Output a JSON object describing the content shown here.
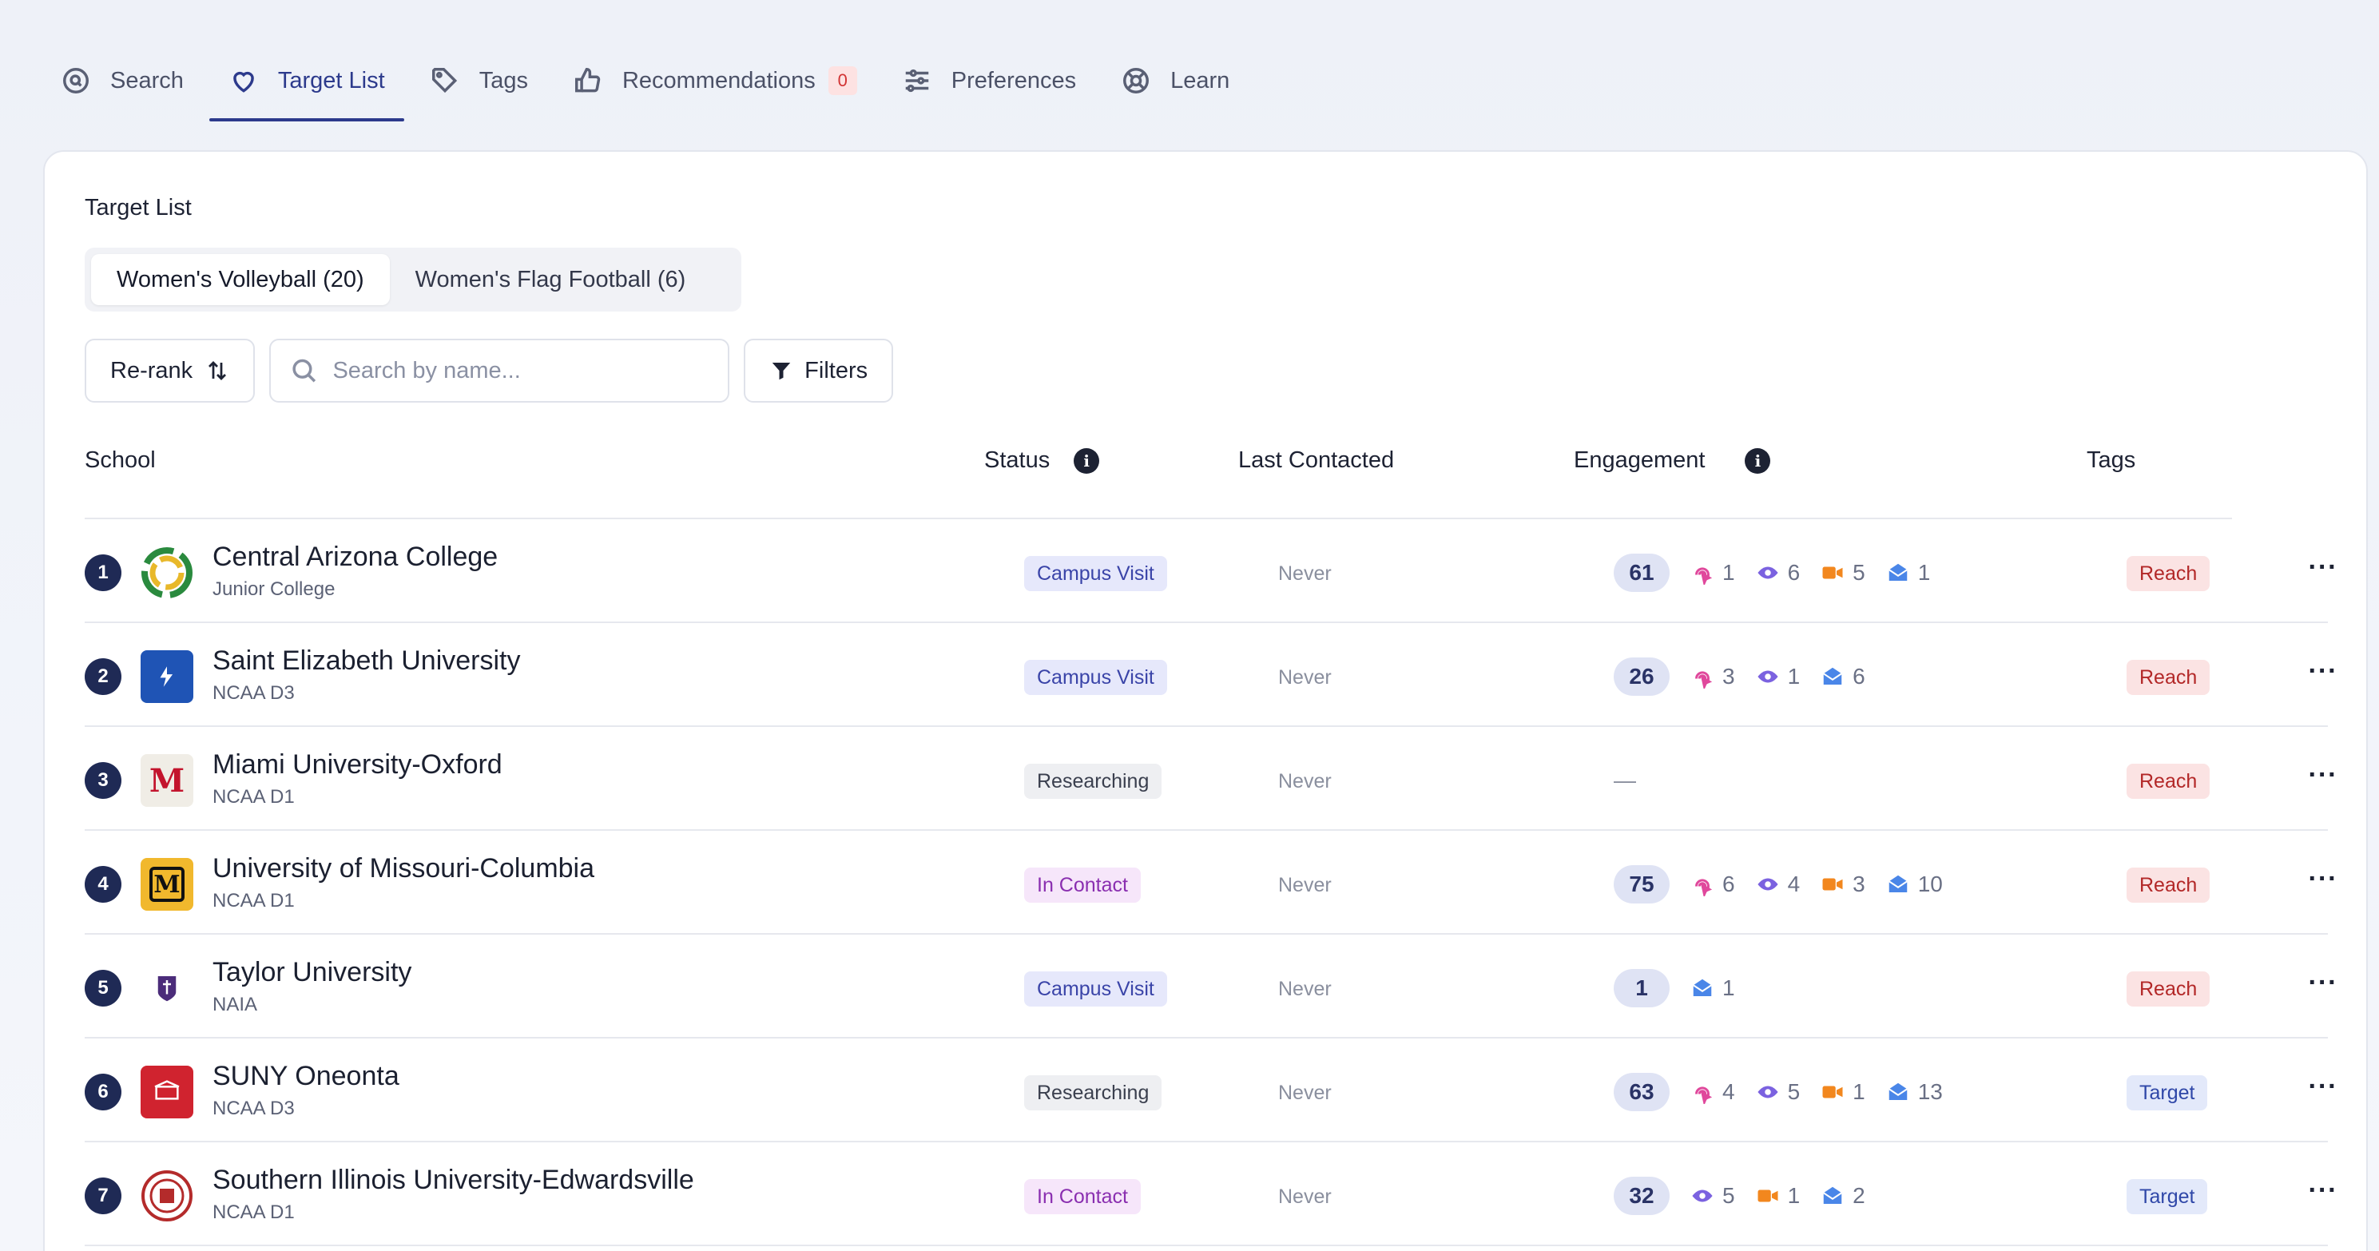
{
  "nav": {
    "tabs": [
      {
        "label": "Search",
        "icon": "search-icon"
      },
      {
        "label": "Target List",
        "icon": "heart-icon",
        "active": true
      },
      {
        "label": "Tags",
        "icon": "tag-icon"
      },
      {
        "label": "Recommendations",
        "icon": "thumbs-up-icon",
        "badge": "0"
      },
      {
        "label": "Preferences",
        "icon": "sliders-icon"
      },
      {
        "label": "Learn",
        "icon": "lifebuoy-icon"
      }
    ]
  },
  "card": {
    "title": "Target List",
    "segments": [
      {
        "label": "Women's Volleyball (20)",
        "active": true
      },
      {
        "label": "Women's Flag Football (6)"
      }
    ],
    "toolbar": {
      "rerank_label": "Re-rank",
      "search_placeholder": "Search by name...",
      "filters_label": "Filters"
    }
  },
  "table": {
    "headers": {
      "school": "School",
      "status": "Status",
      "last_contacted": "Last Contacted",
      "engagement": "Engagement",
      "tags": "Tags"
    },
    "rows": [
      {
        "rank": "1",
        "name": "Central Arizona College",
        "division": "Junior College",
        "status": "Campus Visit",
        "status_kind": "visit",
        "last": "Never",
        "score": "61",
        "pages": "1",
        "views": "6",
        "videos": "5",
        "emails": "1",
        "tag": "Reach",
        "tag_kind": "reach"
      },
      {
        "rank": "2",
        "name": "Saint Elizabeth University",
        "division": "NCAA D3",
        "status": "Campus Visit",
        "status_kind": "visit",
        "last": "Never",
        "score": "26",
        "pages": "3",
        "views": "1",
        "videos": null,
        "emails": "6",
        "tag": "Reach",
        "tag_kind": "reach"
      },
      {
        "rank": "3",
        "name": "Miami University-Oxford",
        "division": "NCAA D1",
        "status": "Researching",
        "status_kind": "research",
        "last": "Never",
        "score": null,
        "empty": "—",
        "tag": "Reach",
        "tag_kind": "reach"
      },
      {
        "rank": "4",
        "name": "University of Missouri-Columbia",
        "division": "NCAA D1",
        "status": "In Contact",
        "status_kind": "contact",
        "last": "Never",
        "score": "75",
        "pages": "6",
        "views": "4",
        "videos": "3",
        "emails": "10",
        "tag": "Reach",
        "tag_kind": "reach"
      },
      {
        "rank": "5",
        "name": "Taylor University",
        "division": "NAIA",
        "status": "Campus Visit",
        "status_kind": "visit",
        "last": "Never",
        "score": "1",
        "pages": null,
        "views": null,
        "videos": null,
        "emails": "1",
        "tag": "Reach",
        "tag_kind": "reach"
      },
      {
        "rank": "6",
        "name": "SUNY Oneonta",
        "division": "NCAA D3",
        "status": "Researching",
        "status_kind": "research",
        "last": "Never",
        "score": "63",
        "pages": "4",
        "views": "5",
        "videos": "1",
        "emails": "13",
        "tag": "Target",
        "tag_kind": "target"
      },
      {
        "rank": "7",
        "name": "Southern Illinois University-Edwardsville",
        "division": "NCAA D1",
        "status": "In Contact",
        "status_kind": "contact",
        "last": "Never",
        "score": "32",
        "pages": null,
        "views": "5",
        "videos": "1",
        "emails": "2",
        "tag": "Target",
        "tag_kind": "target"
      }
    ]
  },
  "colors": {
    "accent": "#2c3a8c",
    "rank_badge": "#1f2a55",
    "pages_icon": "#e0489c",
    "views_icon": "#7b62e0",
    "videos_icon": "#f2871e",
    "emails_icon": "#4a86e8"
  }
}
